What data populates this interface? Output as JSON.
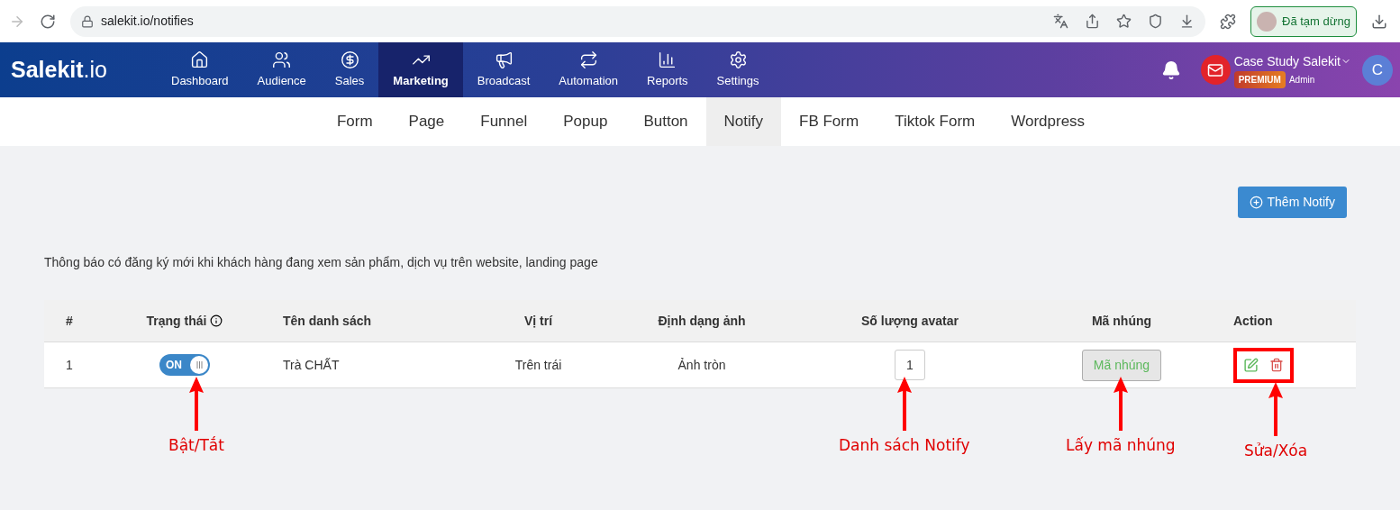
{
  "browser": {
    "url": "salekit.io/notifies",
    "profile_label": "Đã tạm dừng"
  },
  "nav": {
    "logo": "Salekit",
    "logo_suffix": ".io",
    "items": [
      {
        "label": "Dashboard",
        "selected": false
      },
      {
        "label": "Audience",
        "selected": false
      },
      {
        "label": "Sales",
        "selected": false
      },
      {
        "label": "Marketing",
        "selected": true
      },
      {
        "label": "Broadcast",
        "selected": false
      },
      {
        "label": "Automation",
        "selected": false
      },
      {
        "label": "Reports",
        "selected": false
      },
      {
        "label": "Settings",
        "selected": false
      }
    ],
    "account": {
      "name": "Case Study Salekit",
      "plan": "PREMIUM",
      "role": "Admin",
      "initial": "C"
    }
  },
  "subtabs": [
    {
      "label": "Form",
      "selected": false
    },
    {
      "label": "Page",
      "selected": false
    },
    {
      "label": "Funnel",
      "selected": false
    },
    {
      "label": "Popup",
      "selected": false
    },
    {
      "label": "Button",
      "selected": false
    },
    {
      "label": "Notify",
      "selected": true
    },
    {
      "label": "FB Form",
      "selected": false
    },
    {
      "label": "Tiktok Form",
      "selected": false
    },
    {
      "label": "Wordpress",
      "selected": false
    }
  ],
  "add_button": "Thêm Notify",
  "description": "Thông báo có đăng ký mới khi khách hàng đang xem sản phẩm, dịch vụ trên website, landing page",
  "table": {
    "columns": [
      "#",
      "Trạng thái",
      "Tên danh sách",
      "Vị trí",
      "Định dạng ảnh",
      "Số lượng avatar",
      "Mã nhúng",
      "Action"
    ],
    "rows": [
      {
        "index": "1",
        "on": true,
        "toggle_label": "ON",
        "name": "Trà CHẤT",
        "position": "Trên trái",
        "image_format": "Ảnh tròn",
        "avatar_count": "1",
        "embed_button": "Mã nhúng"
      }
    ]
  },
  "annotations": [
    "Bật/Tắt",
    "Danh sách Notify",
    "Lấy mã nhúng",
    "Sửa/Xóa"
  ]
}
